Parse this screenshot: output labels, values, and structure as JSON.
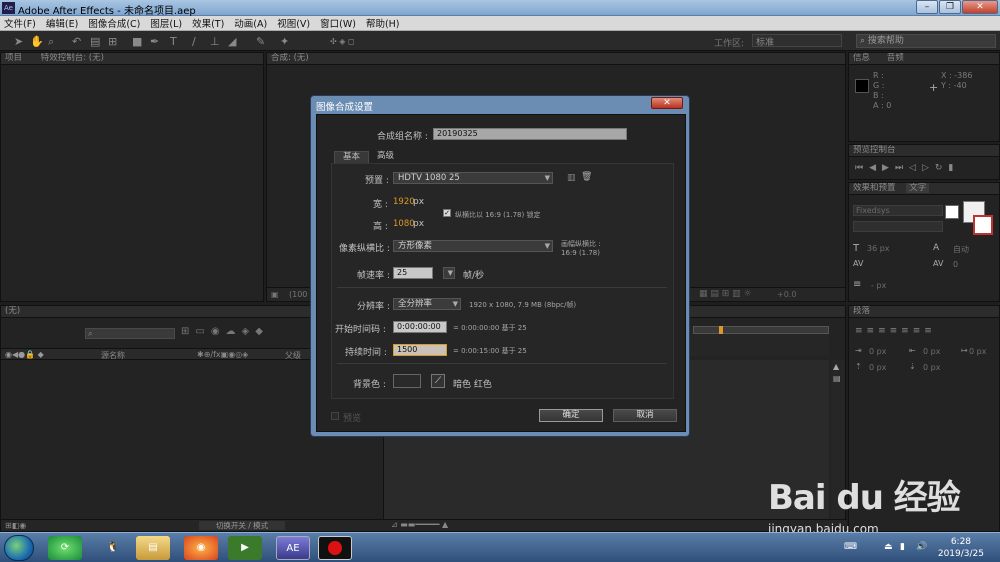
{
  "window": {
    "title": "Adobe After Effects - 未命名项目.aep",
    "app_icon": "Ae"
  },
  "menu": [
    "文件(F)",
    "编辑(E)",
    "图像合成(C)",
    "图层(L)",
    "效果(T)",
    "动画(A)",
    "视图(V)",
    "窗口(W)",
    "帮助(H)"
  ],
  "toolbar": {
    "workspace_label": "工作区:",
    "workspace_value": "标准",
    "search_help": "搜索帮助"
  },
  "panels": {
    "project_tab": "项目",
    "effects_control_tab": "特效控制台: (无)",
    "composition_tab": "合成: (无)",
    "info_tab": "信息",
    "audio_tab": "音频",
    "info_r": "R :",
    "info_g": "G :",
    "info_b": "B :",
    "info_a": "A : 0",
    "info_x": "X : -386",
    "info_y": "Y : -40",
    "preview_tab": "预览控制台",
    "effects_presets_tab": "效果和预置",
    "text_tab": "文字",
    "font_name": "Fixedsys",
    "font_size": "36 px",
    "leading": "自动",
    "tracking_val": "0",
    "stroke_label": "- px",
    "paragraph_tab": "段落",
    "para_indent": "0 px",
    "timeline_tab": "(无)",
    "source_name": "源名称",
    "parent_label": "父级",
    "toggle_label": "切换开关 / 模式",
    "zoom_val": "(100",
    "exposure": "+0.0"
  },
  "dialog": {
    "title": "图像合成设置",
    "comp_name_label": "合成组名称 :",
    "comp_name_value": "20190325",
    "tab_basic": "基本",
    "tab_advanced": "高级",
    "preset_label": "预置 :",
    "preset_value": "HDTV 1080 25",
    "width_label": "宽 :",
    "width_value": "1920",
    "height_label": "高 :",
    "height_value": "1080",
    "unit_px": "px",
    "lock_aspect": "纵横比以 16:9 (1.78) 锁定",
    "par_label": "像素纵横比 :",
    "par_value": "方形像素",
    "frame_aspect_label": "画幅纵横比 :",
    "frame_aspect_value": "16:9 (1.78)",
    "framerate_label": "帧速率 :",
    "framerate_value": "25",
    "framerate_unit": "帧/秒",
    "resolution_label": "分辨率 :",
    "resolution_value": "全分辨率",
    "resolution_info": "1920 x 1080, 7.9 MB (8bpc/帧)",
    "start_label": "开始时间码 :",
    "start_value": "0:00:00:00",
    "start_info": "= 0:00:00:00  基于 25",
    "duration_label": "持续时间 :",
    "duration_value": "1500",
    "duration_info": "= 0:00:15:00  基于 25",
    "bg_label": "背景色 :",
    "bg_name": "暗色 红色",
    "preview_label": "预览",
    "ok": "确定",
    "cancel": "取消"
  },
  "taskbar": {
    "time": "6:28",
    "date": "2019/3/25",
    "ae_label": "AE"
  },
  "watermark": {
    "text": "Bai du 经验",
    "url": "jingyan.baidu.com"
  }
}
